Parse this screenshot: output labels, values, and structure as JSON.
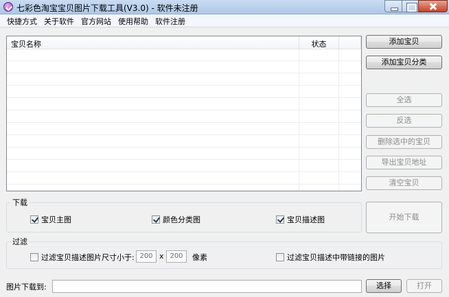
{
  "window": {
    "title": "七彩色淘宝宝贝图片下载工具(V3.0) - 软件未注册"
  },
  "menu": [
    "快捷方式",
    "关于软件",
    "官方网站",
    "使用帮助",
    "软件注册"
  ],
  "list": {
    "columns": [
      "宝贝名称",
      "状态",
      ""
    ]
  },
  "buttons": {
    "add_item": "添加宝贝",
    "add_category": "添加宝贝分类",
    "select_all": "全选",
    "invert": "反选",
    "delete_selected": "删除选中的宝贝",
    "export_address": "导出宝贝地址",
    "clear": "清空宝贝",
    "start_download": "开始下载",
    "choose": "选择",
    "open": "打开"
  },
  "download_group": {
    "label": "下载",
    "options": [
      {
        "label": "宝贝主图",
        "checked": true
      },
      {
        "label": "颜色分类图",
        "checked": true
      },
      {
        "label": "宝贝描述图",
        "checked": true
      }
    ]
  },
  "filter_group": {
    "label": "过滤",
    "size_filter_label": "过滤宝贝描述图片尺寸小于:",
    "width": "200",
    "times": "x",
    "height": "200",
    "unit": "像素",
    "link_filter_label": "过滤宝贝描述中带链接的图片"
  },
  "save_to": {
    "label": "图片下载到:",
    "value": ""
  }
}
